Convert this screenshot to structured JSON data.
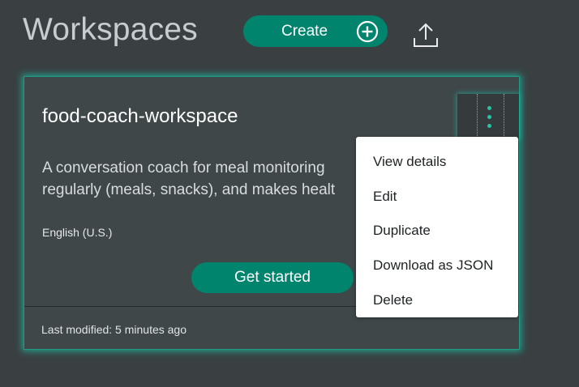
{
  "header": {
    "title": "Workspaces",
    "create_label": "Create"
  },
  "icons": {
    "create": "plus-circle-icon",
    "upload": "upload-icon",
    "more": "kebab-menu-icon"
  },
  "colors": {
    "background": "#3a4042",
    "accent": "#00846e",
    "card_glow": "#1ac4a8",
    "menu_background": "#ffffff"
  },
  "workspace_card": {
    "title": "food-coach-workspace",
    "description_lines": [
      "A conversation coach for meal monitoring",
      "regularly (meals, snacks), and makes healt"
    ],
    "language": "English (U.S.)",
    "get_started_label": "Get started",
    "last_modified": "Last modified: 5 minutes ago"
  },
  "menu": {
    "items": [
      "View details",
      "Edit",
      "Duplicate",
      "Download as JSON",
      "Delete"
    ]
  }
}
